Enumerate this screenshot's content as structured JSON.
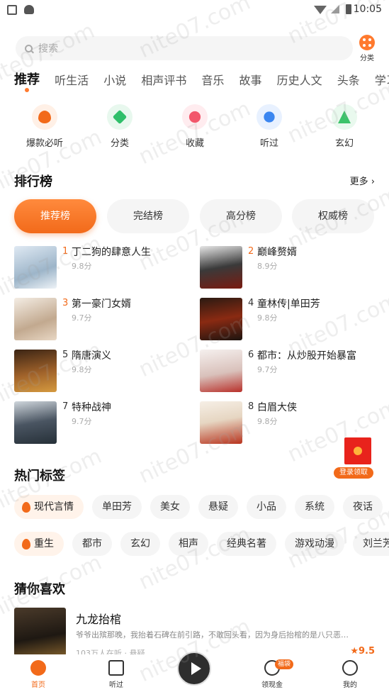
{
  "status_bar": {
    "time": "10:05"
  },
  "search": {
    "placeholder": "搜索",
    "category_label": "分类"
  },
  "tabs": [
    "推荐",
    "听生活",
    "小说",
    "相声评书",
    "音乐",
    "故事",
    "历史人文",
    "头条",
    "学习"
  ],
  "quick_entries": [
    {
      "label": "爆款必听",
      "icon": "flame-icon",
      "color": "#f26a1a"
    },
    {
      "label": "分类",
      "icon": "layers-icon",
      "color": "#2fbf6a"
    },
    {
      "label": "收藏",
      "icon": "heart-icon",
      "color": "#f2566b"
    },
    {
      "label": "听过",
      "icon": "headphone-icon",
      "color": "#3b86f0"
    },
    {
      "label": "玄幻",
      "icon": "mountain-icon",
      "color": "#3cc36a"
    }
  ],
  "ranking": {
    "title": "排行榜",
    "more_label": "更多 ›",
    "tabs": [
      "推荐榜",
      "完结榜",
      "高分榜",
      "权威榜"
    ],
    "items": [
      {
        "rank": "1",
        "title": "丁二狗的肆意人生",
        "score": "9.8分"
      },
      {
        "rank": "2",
        "title": "巅峰赘婿",
        "score": "8.9分"
      },
      {
        "rank": "3",
        "title": "第一豪门女婿",
        "score": "9.7分"
      },
      {
        "rank": "4",
        "title": "童林传|单田芳",
        "score": "9.8分"
      },
      {
        "rank": "5",
        "title": "隋唐演义",
        "score": "9.8分"
      },
      {
        "rank": "6",
        "title": "都市：从炒股开始暴富",
        "score": "9.7分"
      },
      {
        "rank": "7",
        "title": "特种战神",
        "score": "9.7分"
      },
      {
        "rank": "8",
        "title": "白眉大侠",
        "score": "9.8分"
      }
    ]
  },
  "hot_tags": {
    "title": "热门标签",
    "row1": [
      "现代言情",
      "单田芳",
      "美女",
      "悬疑",
      "小品",
      "系统",
      "夜话"
    ],
    "row2": [
      "重生",
      "都市",
      "玄幻",
      "相声",
      "经典名著",
      "游戏动漫",
      "刘兰芳"
    ]
  },
  "red_packet": {
    "label": "登录领取"
  },
  "guess": {
    "title": "猜你喜欢",
    "item": {
      "title": "九龙抬棺",
      "desc": "爷爷出殡那晚，我抬着石碑在前引路，不敢回头看，因为身后抬棺的是八只恶…",
      "meta": "103万人在听 · 悬疑",
      "rating": "★9.5"
    }
  },
  "bottom_nav": [
    {
      "label": "首页",
      "icon": "home-icon"
    },
    {
      "label": "听过",
      "icon": "clock-icon"
    },
    {
      "label": "领现金",
      "icon": "coin-icon",
      "badge": "福袋"
    },
    {
      "label": "我的",
      "icon": "smile-icon"
    }
  ],
  "watermark": "nite07.com"
}
